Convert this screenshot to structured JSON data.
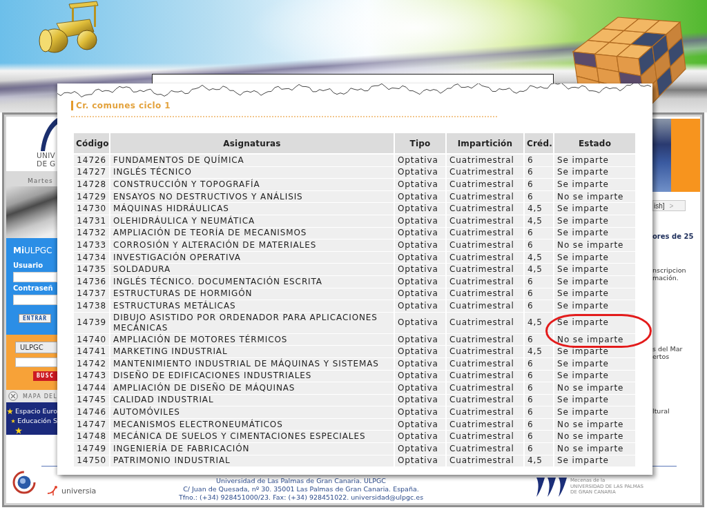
{
  "website": {
    "logo_lines": [
      "UNIV",
      "DE G"
    ],
    "date": "Martes",
    "login": {
      "heading": "**Mi**ULPGC",
      "user_label": "Usuario",
      "password_label": "Contraseñ",
      "button": "ENTRAR"
    },
    "search": {
      "scope": "ULPGC",
      "button": "BUSC"
    },
    "site_map": "MAPA DEL",
    "nav_links": [
      {
        "kind": "link",
        "label": "Espacio Euro"
      },
      {
        "kind": "link",
        "label": "Educación S"
      },
      {
        "kind": "star"
      }
    ],
    "language_button": {
      "label": "ish]",
      "arrow": ">"
    },
    "news_heading": "ores de 25",
    "snippets": [
      [
        "nscripcion",
        "mación."
      ],
      [
        "s del Mar",
        "ertos"
      ],
      [
        "ltural"
      ]
    ],
    "footer": {
      "partner_name": "universia",
      "address_lines": [
        "Universidad de Las Palmas de Gran Canaria. ULPGC",
        "C/ Juan de Quesada, nº 30. 35001 Las Palmas de Gran Canaria. España.",
        "Tfno.: (+34) 928451000/23. Fax: (+34) 928451022. universidad@ulpgc.es"
      ],
      "sponsor_lines": [
        "Mecenas de la",
        "UNIVERSIDAD DE LAS PALMAS",
        "DE GRAN CANARIA"
      ]
    }
  },
  "table_panel": {
    "title": "Cr. comunes ciclo 1",
    "columns": [
      "Código",
      "Asignaturas",
      "Tipo",
      "Impartición",
      "Créd.",
      "Estado"
    ],
    "rows": [
      [
        "14726",
        "FUNDAMENTOS DE QUÍMICA",
        "Optativa",
        "Cuatrimestral",
        "6",
        "Se imparte"
      ],
      [
        "14727",
        "INGLÉS TÉCNICO",
        "Optativa",
        "Cuatrimestral",
        "6",
        "Se imparte"
      ],
      [
        "14728",
        "CONSTRUCCIÓN Y TOPOGRAFÍA",
        "Optativa",
        "Cuatrimestral",
        "6",
        "Se imparte"
      ],
      [
        "14729",
        "ENSAYOS NO DESTRUCTIVOS Y ANÁLISIS",
        "Optativa",
        "Cuatrimestral",
        "6",
        "No se imparte"
      ],
      [
        "14730",
        "MÁQUINAS HIDRÁULICAS",
        "Optativa",
        "Cuatrimestral",
        "4,5",
        "Se imparte"
      ],
      [
        "14731",
        "OLEHIDRÁULICA Y NEUMÁTICA",
        "Optativa",
        "Cuatrimestral",
        "4,5",
        "Se imparte"
      ],
      [
        "14732",
        "AMPLIACIÓN DE TEORÍA DE MECANISMOS",
        "Optativa",
        "Cuatrimestral",
        "6",
        "Se imparte"
      ],
      [
        "14733",
        "CORROSIÓN Y ALTERACIÓN DE MATERIALES",
        "Optativa",
        "Cuatrimestral",
        "6",
        "No se imparte"
      ],
      [
        "14734",
        "INVESTIGACIÓN OPERATIVA",
        "Optativa",
        "Cuatrimestral",
        "4,5",
        "Se imparte"
      ],
      [
        "14735",
        "SOLDADURA",
        "Optativa",
        "Cuatrimestral",
        "4,5",
        "Se imparte"
      ],
      [
        "14736",
        "INGLÉS TÉCNICO. DOCUMENTACIÓN ESCRITA",
        "Optativa",
        "Cuatrimestral",
        "6",
        "Se imparte"
      ],
      [
        "14737",
        "ESTRUCTURAS DE HORMIGÓN",
        "Optativa",
        "Cuatrimestral",
        "6",
        "Se imparte"
      ],
      [
        "14738",
        "ESTRUCTURAS METÁLICAS",
        "Optativa",
        "Cuatrimestral",
        "6",
        "Se imparte"
      ],
      [
        "14739",
        "DIBUJO ASISTIDO POR ORDENADOR PARA APLICACIONES MECÁNICAS",
        "Optativa",
        "Cuatrimestral",
        "4,5",
        "Se imparte"
      ],
      [
        "14740",
        "AMPLIACIÓN DE MOTORES TÉRMICOS",
        "Optativa",
        "Cuatrimestral",
        "6",
        "No se imparte"
      ],
      [
        "14741",
        "MARKETING INDUSTRIAL",
        "Optativa",
        "Cuatrimestral",
        "4,5",
        "Se imparte"
      ],
      [
        "14742",
        "MANTENIMIENTO INDUSTRIAL DE MÁQUINAS Y SISTEMAS",
        "Optativa",
        "Cuatrimestral",
        "6",
        "Se imparte"
      ],
      [
        "14743",
        "DISEÑO DE EDIFICACIONES INDUSTRIALES",
        "Optativa",
        "Cuatrimestral",
        "6",
        "Se imparte"
      ],
      [
        "14744",
        "AMPLIACIÓN DE DISEÑO DE MÁQUINAS",
        "Optativa",
        "Cuatrimestral",
        "6",
        "No se imparte"
      ],
      [
        "14745",
        "CALIDAD INDUSTRIAL",
        "Optativa",
        "Cuatrimestral",
        "6",
        "Se imparte"
      ],
      [
        "14746",
        "AUTOMÓVILES",
        "Optativa",
        "Cuatrimestral",
        "6",
        "Se imparte"
      ],
      [
        "14747",
        "MECANISMOS ELECTRONEUMÁTICOS",
        "Optativa",
        "Cuatrimestral",
        "6",
        "No se imparte"
      ],
      [
        "14748",
        "MECÁNICA DE SUELOS Y CIMENTACIONES ESPECIALES",
        "Optativa",
        "Cuatrimestral",
        "6",
        "No se imparte"
      ],
      [
        "14749",
        "INGENIERÍA DE FABRICACIÓN",
        "Optativa",
        "Cuatrimestral",
        "6",
        "No se imparte"
      ],
      [
        "14750",
        "PATRIMONIO INDUSTRIAL",
        "Optativa",
        "Cuatrimestral",
        "4,5",
        "Se imparte"
      ]
    ]
  }
}
